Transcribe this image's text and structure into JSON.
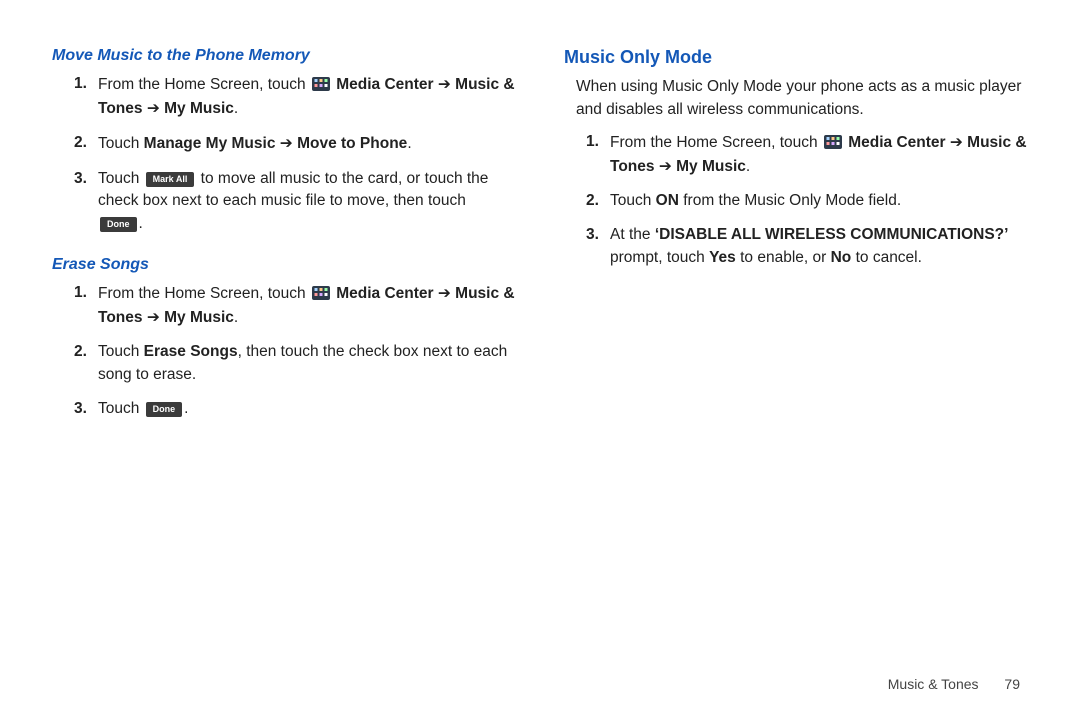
{
  "arrow": "➔",
  "left": {
    "sectionA": {
      "heading": "Move Music to the Phone Memory",
      "step1": {
        "num": "1.",
        "pre": "From the Home Screen, touch ",
        "bold1a": "Media Center ",
        "bold1b": " Music & Tones ",
        "bold1c": " My Music",
        "dot": "."
      },
      "step2": {
        "num": "2.",
        "pre": "Touch ",
        "bold_a": "Manage My Music ",
        "bold_b": " Move to Phone",
        "dot": "."
      },
      "step3": {
        "num": "3.",
        "pre": "Touch ",
        "btn_markall": "Mark All",
        "mid": " to move all music to the card, or touch the check box next to each music file to move, then touch ",
        "btn_done": "Done",
        "dot": "."
      }
    },
    "sectionB": {
      "heading": "Erase Songs",
      "step1": {
        "num": "1.",
        "pre": "From the Home Screen, touch ",
        "bold1a": "Media Center ",
        "bold1b": " Music & Tones ",
        "bold1c": " My Music",
        "dot": "."
      },
      "step2": {
        "num": "2.",
        "pre": "Touch ",
        "bold": "Erase Songs",
        "post": ", then touch the check box next to each song to erase."
      },
      "step3": {
        "num": "3.",
        "pre": "Touch ",
        "btn_done": "Done",
        "dot": "."
      }
    }
  },
  "right": {
    "heading": "Music Only Mode",
    "intro": "When using Music Only Mode your phone acts as a music player and disables all wireless communications.",
    "step1": {
      "num": "1.",
      "pre": "From the Home Screen, touch ",
      "bold1a": "Media Center ",
      "bold1b": " Music & Tones ",
      "bold1c": " My Music",
      "dot": "."
    },
    "step2": {
      "num": "2.",
      "pre": "Touch ",
      "bold": "ON",
      "post": " from the Music Only Mode field."
    },
    "step3": {
      "num": "3.",
      "pre": "At the ",
      "bold": "‘DISABLE ALL WIRELESS COMMUNICATIONS?’",
      "mid": " prompt, touch ",
      "bold_yes": "Yes",
      "mid2": " to enable, or ",
      "bold_no": "No",
      "post": " to cancel."
    }
  },
  "footer": {
    "section": "Music & Tones",
    "page": "79"
  }
}
